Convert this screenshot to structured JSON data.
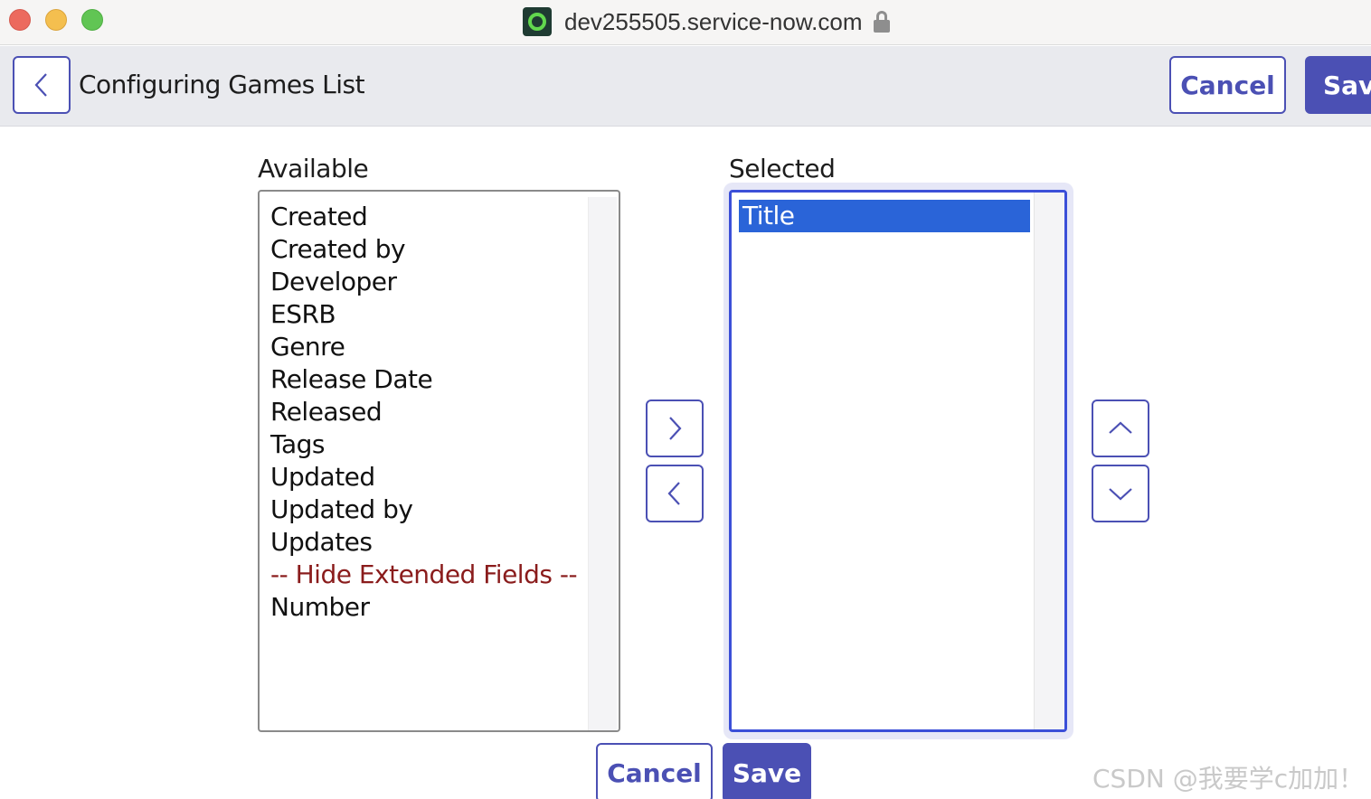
{
  "browser": {
    "url": "dev255505.service-now.com"
  },
  "header": {
    "title": "Configuring Games List",
    "cancel_label": "Cancel",
    "save_label": "Save"
  },
  "available": {
    "label": "Available",
    "items": [
      {
        "label": "Created"
      },
      {
        "label": "Created by"
      },
      {
        "label": "Developer"
      },
      {
        "label": "ESRB"
      },
      {
        "label": "Genre"
      },
      {
        "label": "Release Date"
      },
      {
        "label": "Released"
      },
      {
        "label": "Tags"
      },
      {
        "label": "Updated"
      },
      {
        "label": "Updated by"
      },
      {
        "label": "Updates"
      },
      {
        "label": "-- Hide Extended Fields --"
      },
      {
        "label": "Number"
      }
    ]
  },
  "selected": {
    "label": "Selected",
    "items": [
      {
        "label": "Title"
      }
    ]
  },
  "footer": {
    "cancel_label": "Cancel",
    "save_label": "Save"
  },
  "watermark": "CSDN @我要学c加加！",
  "colors": {
    "accent": "#4b50b4",
    "selection": "#2a64d8",
    "extended_fields_text": "#8a1c1c"
  }
}
